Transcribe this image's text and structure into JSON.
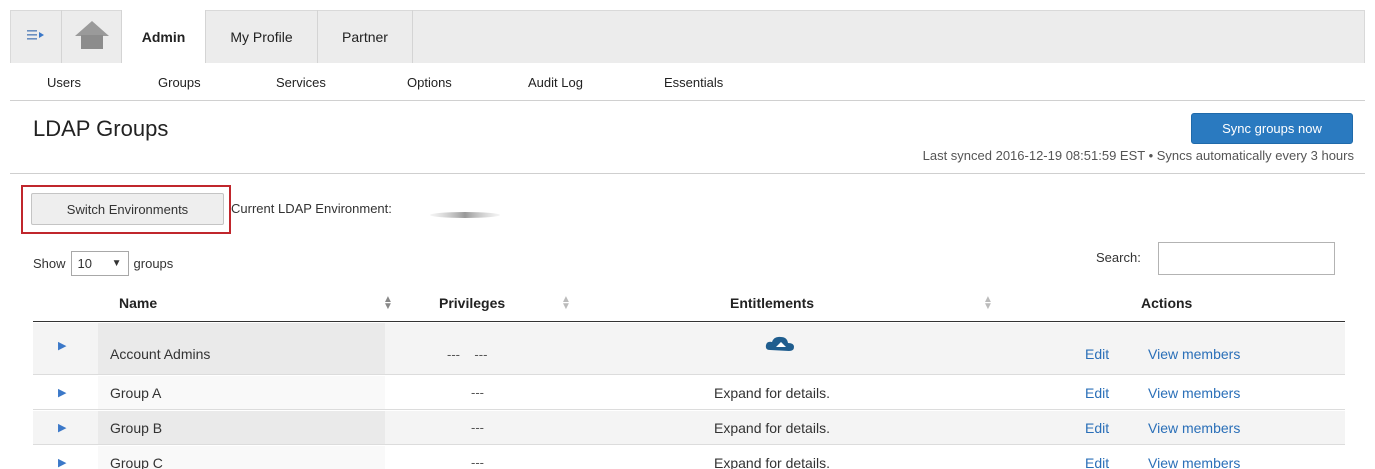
{
  "nav": {
    "menu_icon": "menu-expand-icon",
    "home_icon": "home-icon",
    "tabs": [
      "Admin",
      "My Profile",
      "Partner"
    ]
  },
  "subnav": [
    "Users",
    "Groups",
    "Services",
    "Options",
    "Audit Log",
    "Essentials"
  ],
  "page": {
    "title": "LDAP Groups",
    "sync_button": "Sync groups now",
    "sync_info": "Last synced 2016-12-19 08:51:59 EST  •  Syncs automatically every 3 hours"
  },
  "environment": {
    "switch_button": "Switch Environments",
    "label": "Current LDAP Environment:"
  },
  "controls": {
    "show_label": "Show",
    "page_size": "10",
    "groups_label": "groups",
    "search_label": "Search:",
    "search_value": ""
  },
  "table": {
    "headers": [
      "Name",
      "Privileges",
      "Entitlements",
      "Actions"
    ],
    "rows": [
      {
        "name": "Account Admins",
        "privileges": "---    ---",
        "entitlements": "",
        "entitlement_icon": "cloud-icon",
        "edit": "Edit",
        "view": "View members"
      },
      {
        "name": "Group A",
        "privileges": "---",
        "entitlements": "Expand for details.",
        "edit": "Edit",
        "view": "View members"
      },
      {
        "name": "Group B",
        "privileges": "---",
        "entitlements": "Expand for details.",
        "edit": "Edit",
        "view": "View members"
      },
      {
        "name": "Group C",
        "privileges": "---",
        "entitlements": "Expand for details.",
        "edit": "Edit",
        "view": "View members"
      }
    ]
  },
  "colors": {
    "primary": "#2a7ac0",
    "link": "#2a6fb8",
    "highlight_border": "#c0262c"
  }
}
